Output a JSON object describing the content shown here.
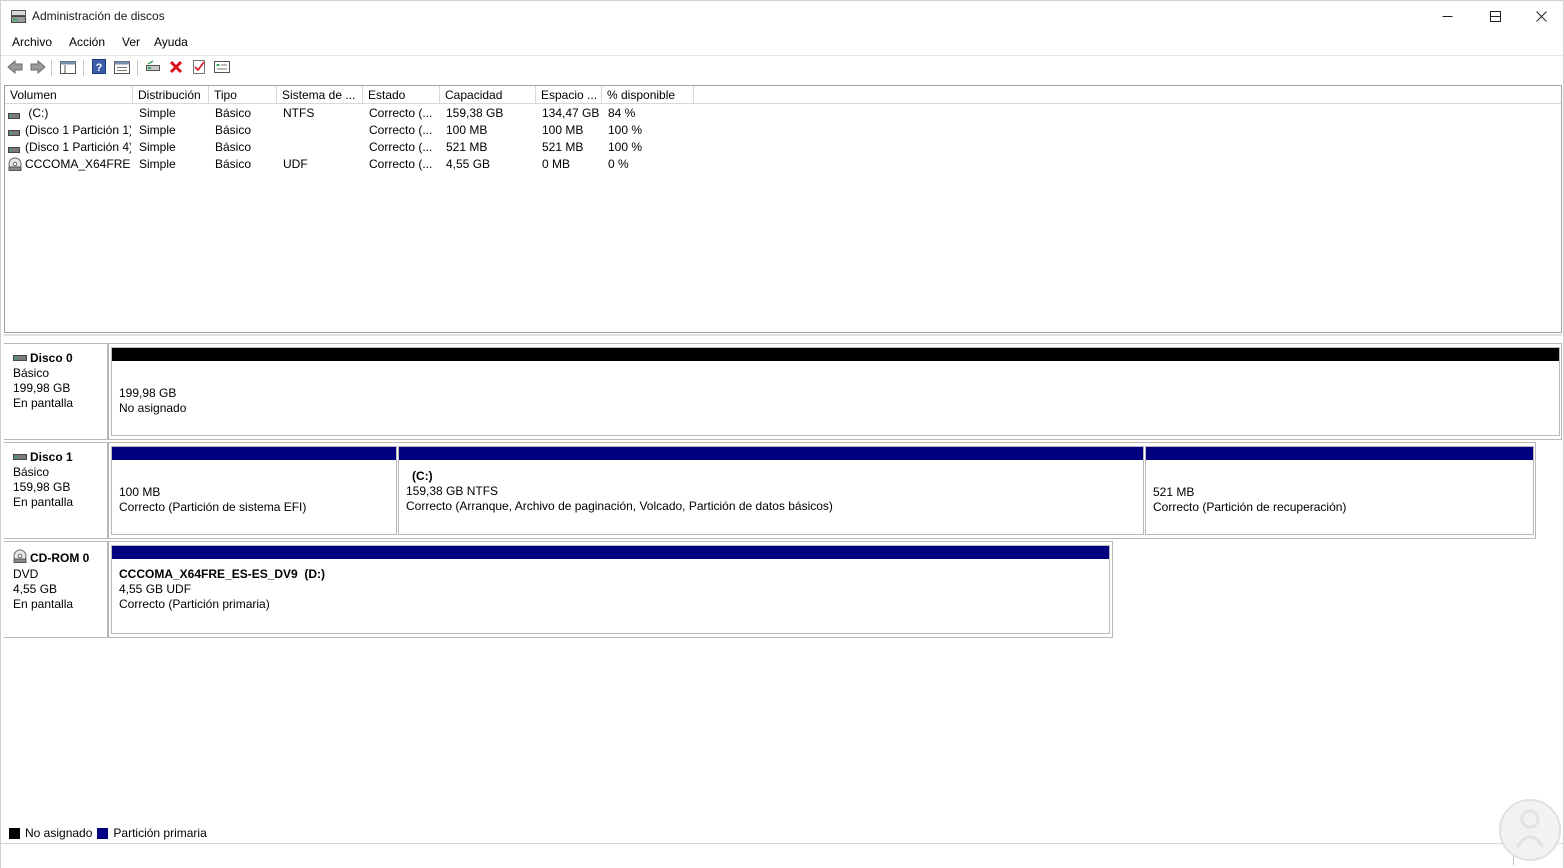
{
  "window": {
    "title": "Administración de discos",
    "app_icon": "disk-management-icon",
    "controls": [
      "minimize-icon",
      "maximize-icon",
      "close-icon"
    ]
  },
  "menu": {
    "items": [
      {
        "label": "Archivo"
      },
      {
        "label": "Acción"
      },
      {
        "label": "Ver"
      },
      {
        "label": "Ayuda"
      }
    ]
  },
  "toolbar": {
    "buttons": [
      "back-icon",
      "forward-icon",
      "show-console-tree-icon",
      "help-icon",
      "properties-view-icon",
      "connect-disk-icon",
      "delete-icon",
      "check-icon",
      "properties-icon"
    ]
  },
  "volume_list": {
    "columns": [
      "Volumen",
      "Distribución",
      "Tipo",
      "Sistema de ...",
      "Estado",
      "Capacidad",
      "Espacio ...",
      "% disponible"
    ],
    "rows": [
      {
        "icon": "drive-icon",
        "volume": " (C:)",
        "layout": "Simple",
        "type": "Básico",
        "fs": "NTFS",
        "status": "Correcto (...",
        "capacity": "159,38 GB",
        "free": "134,47 GB",
        "pct": "84 %"
      },
      {
        "icon": "drive-icon",
        "volume": "(Disco 1 Partición 1)",
        "layout": "Simple",
        "type": "Básico",
        "fs": "",
        "status": "Correcto (...",
        "capacity": "100 MB",
        "free": "100 MB",
        "pct": "100 %"
      },
      {
        "icon": "drive-icon",
        "volume": "(Disco 1 Partición 4)",
        "layout": "Simple",
        "type": "Básico",
        "fs": "",
        "status": "Correcto (...",
        "capacity": "521 MB",
        "free": "521 MB",
        "pct": "100 %"
      },
      {
        "icon": "cd-icon",
        "volume": "CCCOMA_X64FRE...",
        "layout": "Simple",
        "type": "Básico",
        "fs": "UDF",
        "status": "Correcto (...",
        "capacity": "4,55 GB",
        "free": "0 MB",
        "pct": "0 %"
      }
    ]
  },
  "disks": [
    {
      "name": "Disco 0",
      "type": "Básico",
      "size": "199,98 GB",
      "state": "En pantalla",
      "partitions": [
        {
          "title": "",
          "line1": "199,98 GB",
          "line2": "No asignado",
          "color": "#000000"
        }
      ]
    },
    {
      "name": "Disco 1",
      "type": "Básico",
      "size": "159,98 GB",
      "state": "En pantalla",
      "partitions": [
        {
          "title": "",
          "line1": "100 MB",
          "line2": "Correcto (Partición de sistema EFI)",
          "color": "#000080"
        },
        {
          "title": "(C:)",
          "line1": "159,38 GB NTFS",
          "line2": "Correcto (Arranque, Archivo de paginación, Volcado, Partición de datos básicos)",
          "color": "#000080"
        },
        {
          "title": "",
          "line1": "521 MB",
          "line2": "Correcto (Partición de recuperación)",
          "color": "#000080"
        }
      ]
    },
    {
      "name": "CD-ROM 0",
      "type": "DVD",
      "size": "4,55 GB",
      "state": "En pantalla",
      "partitions": [
        {
          "title": "CCCOMA_X64FRE_ES-ES_DV9  (D:)",
          "line1": "4,55 GB UDF",
          "line2": "Correcto (Partición primaria)",
          "color": "#000080"
        }
      ]
    }
  ],
  "legend": [
    {
      "label": "No asignado",
      "color": "#000000"
    },
    {
      "label": "Partición primaria",
      "color": "#000080"
    }
  ]
}
